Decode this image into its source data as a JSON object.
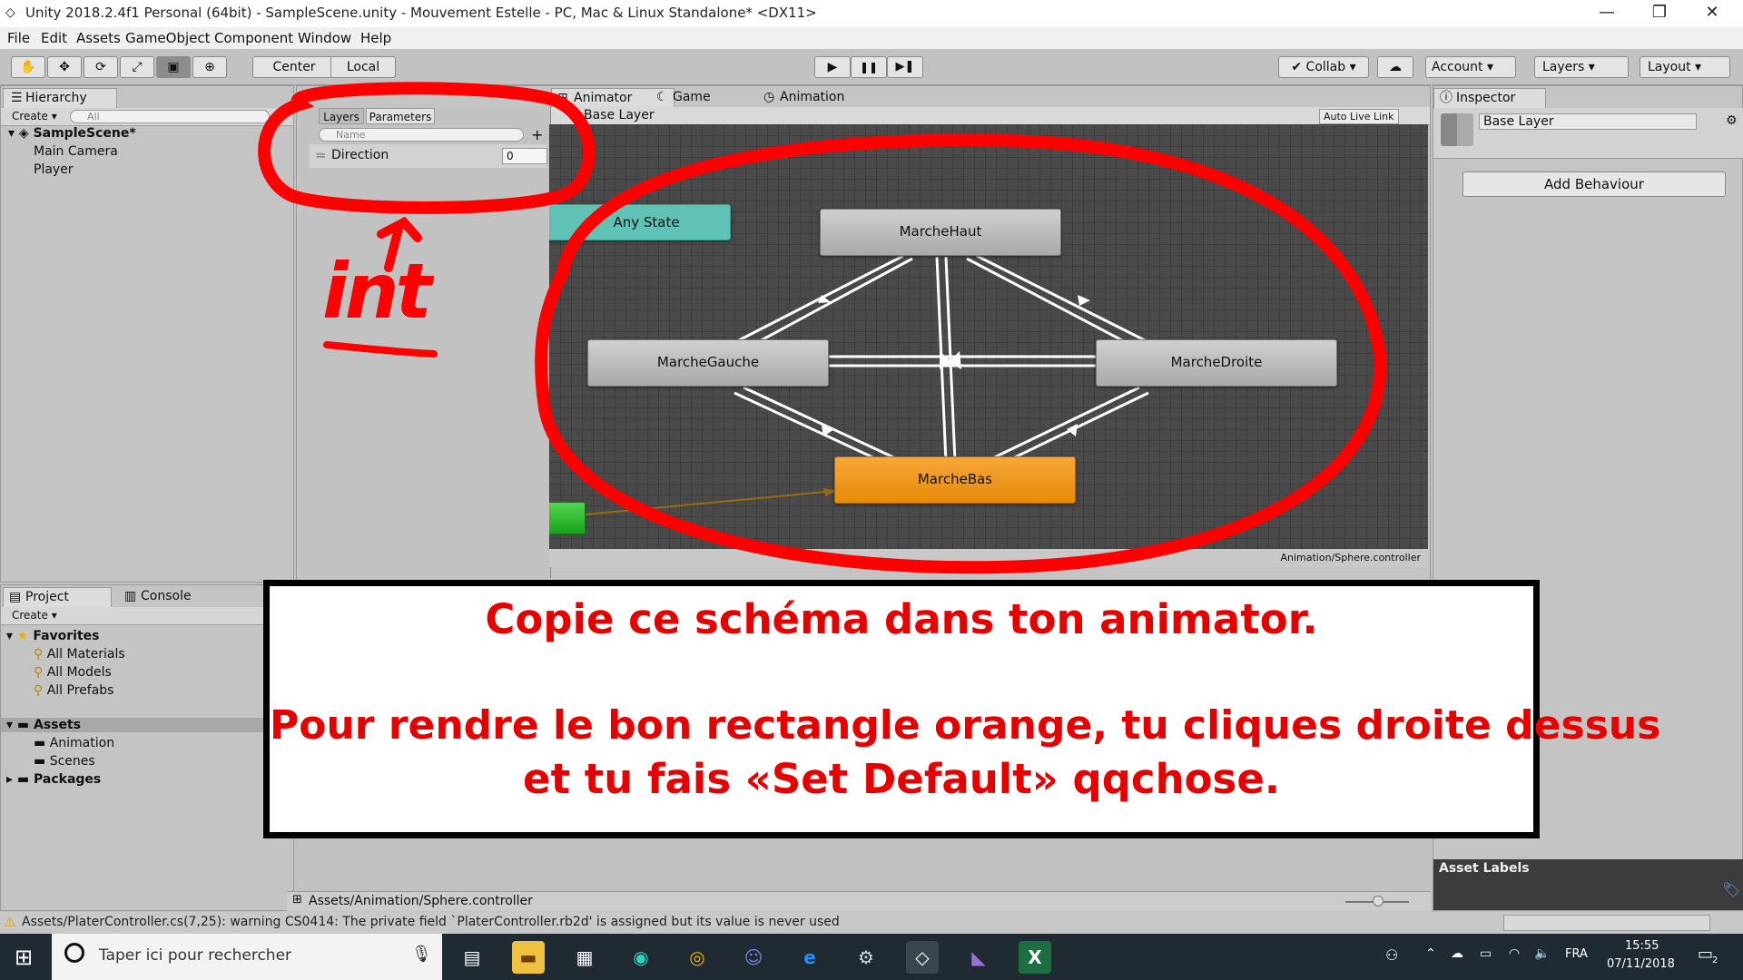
{
  "window": {
    "title": "Unity 2018.2.4f1 Personal (64bit) - SampleScene.unity - Mouvement Estelle - PC, Mac & Linux Standalone* <DX11>",
    "minimize": "—",
    "restore": "❐",
    "close": "✕"
  },
  "menu": [
    "File",
    "Edit",
    "Assets",
    "GameObject",
    "Component",
    "Window",
    "Help"
  ],
  "toolbar": {
    "tools": [
      "hand-icon",
      "move-icon",
      "rotate-icon",
      "scale-icon",
      "rect-icon",
      "transform-icon"
    ],
    "center_label": "Center",
    "local_label": "Local",
    "play": "▶",
    "pause": "❚❚",
    "step": "▶❚",
    "collab_label": "Collab",
    "account_label": "Account",
    "layers_label": "Layers",
    "layout_label": "Layout"
  },
  "hierarchy": {
    "tab": "Hierarchy",
    "create": "Create",
    "search_placeholder": "All",
    "scene": "SampleScene*",
    "items": [
      "Main Camera",
      "Player"
    ]
  },
  "animator_panel": {
    "tabs": [
      "Animator",
      "Game",
      "Animation"
    ],
    "sub_tabs": [
      "Layers",
      "Parameters"
    ],
    "search_placeholder": "Name",
    "param_name": "Direction",
    "param_value": "0",
    "base_layer": "Base Layer",
    "auto_live_link": "Auto Live Link",
    "footer_path": "Animation/Sphere.controller"
  },
  "graph": {
    "nodes": [
      {
        "label": "Any State"
      },
      {
        "label": "MarcheHaut"
      },
      {
        "label": "MarcheGauche"
      },
      {
        "label": "MarcheDroite"
      },
      {
        "label": "MarcheBas"
      }
    ]
  },
  "annotation": {
    "handwritten": "int",
    "color": "#ff0000"
  },
  "inspector": {
    "tab": "Inspector",
    "name_value": "Base Layer",
    "add_behaviour": "Add Behaviour",
    "asset_labels": "Asset Labels"
  },
  "project": {
    "tabs": [
      "Project",
      "Console"
    ],
    "create": "Create",
    "favorites": "Favorites",
    "favorite_items": [
      "All Materials",
      "All Models",
      "All Prefabs"
    ],
    "assets": "Assets",
    "asset_items": [
      "Animation",
      "Scenes"
    ],
    "packages": "Packages"
  },
  "message": {
    "line1": "Copie ce schéma dans ton animator.",
    "line2": "Pour rendre le bon rectangle orange, tu cliques droite dessus",
    "line3": "et tu fais «Set Default» qqchose."
  },
  "bottom_path": "Assets/Animation/Sphere.controller",
  "status_warning": "Assets/PlaterController.cs(7,25): warning CS0414: The private field `PlaterController.rb2d' is assigned but its value is never used",
  "taskbar": {
    "search_placeholder": "Taper ici pour rechercher",
    "lang": "FRA",
    "time": "15:55",
    "date": "07/11/2018",
    "notification_count": "2"
  }
}
